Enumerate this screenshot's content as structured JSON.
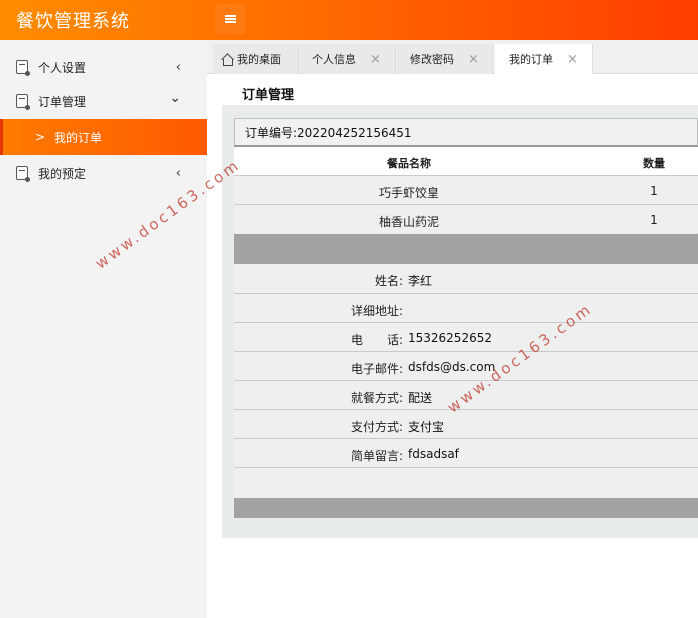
{
  "header": {
    "title": "餐饮管理系统"
  },
  "sidebar": {
    "items": [
      {
        "label": "个人设置",
        "arrow": "‹"
      },
      {
        "label": "订单管理",
        "arrow": "⌄"
      },
      {
        "label": "我的订单",
        "arrow": ">"
      },
      {
        "label": "我的预定",
        "arrow": "‹"
      }
    ]
  },
  "tabs": [
    {
      "label": "我的桌面"
    },
    {
      "label": "个人信息",
      "close": "×"
    },
    {
      "label": "修改密码",
      "close": "×"
    },
    {
      "label": "我的订单",
      "close": "×"
    }
  ],
  "main": {
    "title": "订单管理",
    "order_no_label": "订单编号:",
    "order_no": "202204252156451",
    "table": {
      "headers": [
        "餐品名称",
        "数量"
      ],
      "rows": [
        [
          "巧手虾饺皇",
          "1"
        ],
        [
          "柚香山药泥",
          "1"
        ]
      ]
    },
    "info": [
      {
        "label": "姓名:",
        "value": "李红"
      },
      {
        "label": "详细地址:",
        "value": ""
      },
      {
        "label": "电　　话:",
        "value": "15326252652"
      },
      {
        "label": "电子邮件:",
        "value": "dsfds@ds.com"
      },
      {
        "label": "就餐方式:",
        "value": "配送"
      },
      {
        "label": "支付方式:",
        "value": "支付宝"
      },
      {
        "label": "简单留言:",
        "value": "fdsadsaf"
      }
    ]
  },
  "watermarks": [
    "www.doc163.com",
    "www.doc163.com"
  ],
  "colors": {
    "accent": "#ff6a00",
    "header_end": "#ff3d00",
    "watermark": "#c0392b"
  }
}
